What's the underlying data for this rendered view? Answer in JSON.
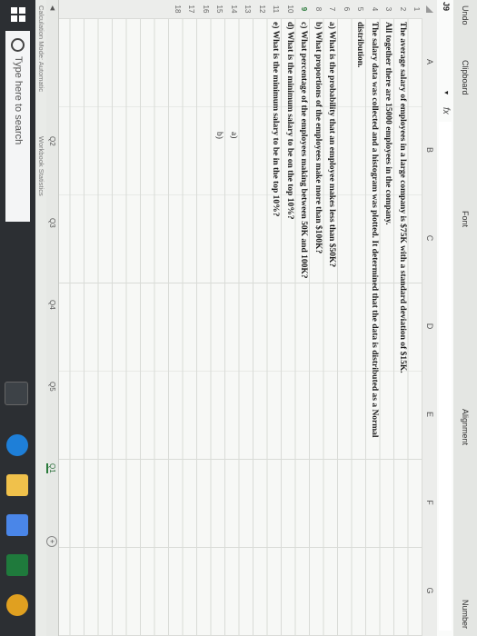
{
  "ribbon": {
    "undo": "Undo",
    "clipboard": "Clipboard",
    "font": "Font",
    "alignment": "Alignment",
    "number": "Number"
  },
  "formula_bar": {
    "name_box": "J9",
    "fx": "fx"
  },
  "columns": [
    "A",
    "B",
    "C",
    "D",
    "E",
    "F",
    "G"
  ],
  "rows": [
    "1",
    "2",
    "3",
    "4",
    "5",
    "6",
    "7",
    "8",
    "9",
    "10",
    "11",
    "12",
    "13",
    "14",
    "15",
    "16",
    "17",
    "18"
  ],
  "cells": {
    "r2": "The average salary of employees in a large company is $75K with a standard deviation of $15K.",
    "r3": "All together there are 15000 employees in the company.",
    "r4": "The salary data was collected and a histogram  was plotted. It determined that the data is distributed as a Normal",
    "r5": "distribution.",
    "r7": "a)  What is the probability  that an employee makes less than $50K?",
    "r8": "b)  What proportions of the employees make more than $100K?",
    "r9": "c)  What percentage of the employees  making between 50K and 100K?",
    "r10": "d)  What is the minimum salary to be on the top 10%?",
    "r11": "e) What is the minimum  salary to be in the top 10%?",
    "r14": "a)",
    "r15": "b)"
  },
  "sheet_tabs": [
    "Q2",
    "Q3",
    "Q4",
    "Q5",
    "Q1"
  ],
  "add_sheet": "+",
  "status": {
    "calc_mode": "Calculation Mode: Automatic",
    "workbook_stats": "Workbook Statistics"
  },
  "taskbar": {
    "search_placeholder": "Type here to search"
  },
  "colors": {
    "active_tab": "#2a7a3a",
    "taskbar": "#2c2f33"
  }
}
